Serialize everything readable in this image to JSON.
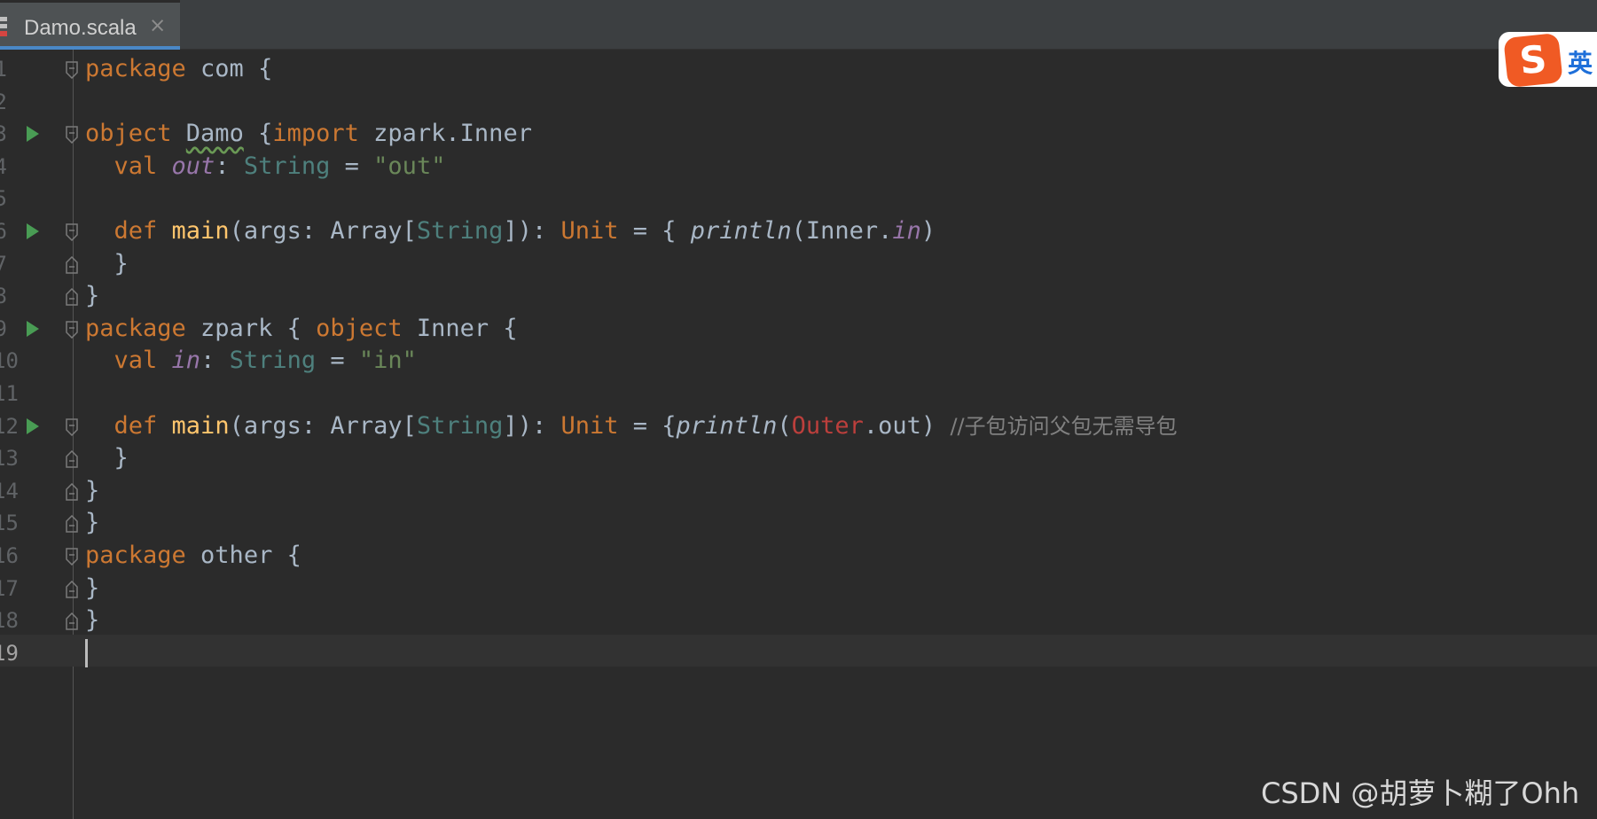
{
  "editor": {
    "tab": {
      "filename": "Damo.scala",
      "close_glyph": "×"
    },
    "current_line": 19,
    "lines": [
      {
        "n": "1",
        "run": false,
        "fold": "open",
        "tokens": [
          [
            "kw",
            "package "
          ],
          [
            "pl",
            "com {"
          ]
        ]
      },
      {
        "n": "2",
        "run": false,
        "fold": "",
        "tokens": []
      },
      {
        "n": "3",
        "run": true,
        "fold": "open",
        "tokens": [
          [
            "kw",
            "object "
          ],
          [
            "ul",
            "Damo"
          ],
          [
            "pl",
            " {"
          ],
          [
            "kw",
            "import "
          ],
          [
            "pl",
            "zpark.Inner"
          ]
        ]
      },
      {
        "n": "4",
        "run": false,
        "fold": "",
        "tokens": [
          [
            "pl",
            "  "
          ],
          [
            "kw",
            "val "
          ],
          [
            "fld",
            "out"
          ],
          [
            "pl",
            ": "
          ],
          [
            "ty",
            "String"
          ],
          [
            "pl",
            " = "
          ],
          [
            "st",
            "\"out\""
          ]
        ]
      },
      {
        "n": "5",
        "run": false,
        "fold": "",
        "tokens": []
      },
      {
        "n": "6",
        "run": true,
        "fold": "open",
        "tokens": [
          [
            "pl",
            "  "
          ],
          [
            "kw",
            "def "
          ],
          [
            "fn",
            "main"
          ],
          [
            "pl",
            "(args: Array["
          ],
          [
            "ty",
            "String"
          ],
          [
            "pl",
            "]): "
          ],
          [
            "kw",
            "Unit"
          ],
          [
            "pl",
            " = { "
          ],
          [
            "it",
            "println"
          ],
          [
            "pl",
            "(Inner."
          ],
          [
            "fld",
            "in"
          ],
          [
            "pl",
            ")"
          ]
        ]
      },
      {
        "n": "7",
        "run": false,
        "fold": "close",
        "tokens": [
          [
            "pl",
            "  }"
          ]
        ]
      },
      {
        "n": "8",
        "run": false,
        "fold": "close",
        "tokens": [
          [
            "pl",
            "}"
          ]
        ]
      },
      {
        "n": "9",
        "run": true,
        "fold": "open",
        "tokens": [
          [
            "kw",
            "package "
          ],
          [
            "pl",
            "zpark { "
          ],
          [
            "kw",
            "object "
          ],
          [
            "pl",
            "Inner {"
          ]
        ]
      },
      {
        "n": "10",
        "run": false,
        "fold": "",
        "tokens": [
          [
            "pl",
            "  "
          ],
          [
            "kw",
            "val "
          ],
          [
            "fld",
            "in"
          ],
          [
            "pl",
            ": "
          ],
          [
            "ty",
            "String"
          ],
          [
            "pl",
            " = "
          ],
          [
            "st",
            "\"in\""
          ]
        ]
      },
      {
        "n": "11",
        "run": false,
        "fold": "",
        "tokens": []
      },
      {
        "n": "12",
        "run": true,
        "fold": "open",
        "tokens": [
          [
            "pl",
            "  "
          ],
          [
            "kw",
            "def "
          ],
          [
            "fn",
            "main"
          ],
          [
            "pl",
            "(args: Array["
          ],
          [
            "ty",
            "String"
          ],
          [
            "pl",
            "]): "
          ],
          [
            "kw",
            "Unit"
          ],
          [
            "pl",
            " = {"
          ],
          [
            "it",
            "println"
          ],
          [
            "pl",
            "("
          ],
          [
            "err",
            "Outer"
          ],
          [
            "pl",
            ".out) "
          ],
          [
            "cm",
            "//子包访问父包无需导包"
          ]
        ]
      },
      {
        "n": "13",
        "run": false,
        "fold": "close",
        "tokens": [
          [
            "pl",
            "  }"
          ]
        ]
      },
      {
        "n": "14",
        "run": false,
        "fold": "close",
        "tokens": [
          [
            "pl",
            "}"
          ]
        ]
      },
      {
        "n": "15",
        "run": false,
        "fold": "close",
        "tokens": [
          [
            "pl",
            "}"
          ]
        ]
      },
      {
        "n": "16",
        "run": false,
        "fold": "open",
        "tokens": [
          [
            "kw",
            "package "
          ],
          [
            "pl",
            "other {"
          ]
        ]
      },
      {
        "n": "17",
        "run": false,
        "fold": "close",
        "tokens": [
          [
            "pl",
            "}"
          ]
        ]
      },
      {
        "n": "18",
        "run": false,
        "fold": "close",
        "tokens": [
          [
            "pl",
            "}"
          ]
        ]
      },
      {
        "n": "19",
        "run": false,
        "fold": "",
        "tokens": []
      }
    ]
  },
  "ime": {
    "logo": "S",
    "label": "英"
  },
  "watermark": "CSDN @胡萝卜糊了Ohh",
  "colors": {
    "background": "#2b2b2b",
    "keyword": "#cc7832",
    "string": "#6a8759",
    "type": "#4e807d",
    "field": "#9876aa",
    "function": "#ffc66d",
    "error": "#bc3f3c",
    "comment": "#808080",
    "run_icon": "#499c54"
  }
}
